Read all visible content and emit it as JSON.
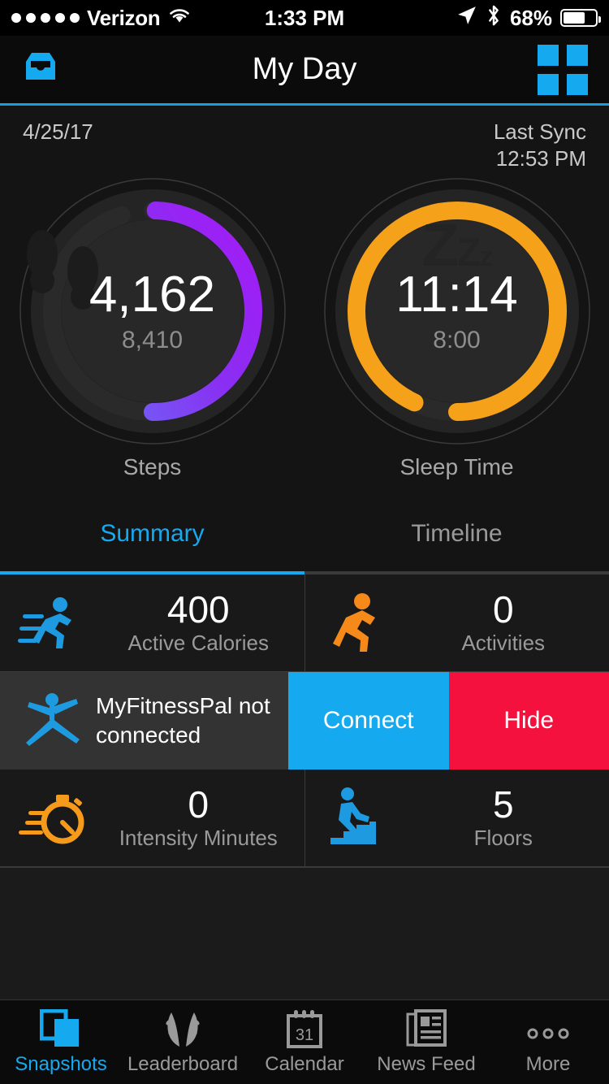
{
  "status_bar": {
    "carrier": "Verizon",
    "signal_dots": 5,
    "wifi_icon": "wifi-icon",
    "time": "1:33 PM",
    "location_icon": "location-arrow-icon",
    "bluetooth_icon": "bluetooth-icon",
    "battery_percent": "68%",
    "battery_level": 68
  },
  "navbar": {
    "inbox_icon": "inbox-tray-icon",
    "title": "My Day",
    "grid_icon": "grid-squares-icon"
  },
  "sync": {
    "date": "4/25/17",
    "last_sync_label": "Last Sync",
    "last_sync_time": "12:53 PM"
  },
  "rings": [
    {
      "name": "steps",
      "value": "4,162",
      "goal": "8,410",
      "label": "Steps",
      "icon": "footprints-icon",
      "progress": 0.495,
      "color_start": "#6a6cf5",
      "color_end": "#a21cf5",
      "track_color": "#2a2a2a"
    },
    {
      "name": "sleep",
      "value": "11:14",
      "goal": "8:00",
      "label": "Sleep Time",
      "icon": "zzz-sleep-icon",
      "progress": 0.93,
      "color_start": "#F5A21A",
      "color_end": "#F5A21A",
      "track_color": "#2a2a2a"
    }
  ],
  "tabs": {
    "items": [
      {
        "label": "Summary",
        "active": true
      },
      {
        "label": "Timeline",
        "active": false
      }
    ],
    "active_color": "#15A9EF"
  },
  "stats": {
    "row1": [
      {
        "value": "400",
        "label": "Active Calories",
        "icon": "running-person-icon",
        "color": "#1E9BE0"
      },
      {
        "value": "0",
        "label": "Activities",
        "icon": "running-person-icon",
        "color": "#F58A1A"
      }
    ],
    "row3": [
      {
        "value": "0",
        "label": "Intensity Minutes",
        "icon": "stopwatch-icon",
        "color": "#F59A1A"
      },
      {
        "value": "5",
        "label": "Floors",
        "icon": "stairs-climber-icon",
        "color": "#1E9BE0"
      }
    ]
  },
  "mfp": {
    "icon": "jumping-person-icon",
    "message": "MyFitnessPal not connected",
    "connect_label": "Connect",
    "hide_label": "Hide",
    "connect_color": "#15A9EF",
    "hide_color": "#F4113D"
  },
  "page_dots": {
    "count": 6,
    "active_index": 0
  },
  "tabbar": {
    "items": [
      {
        "label": "Snapshots",
        "icon": "snapshots-cards-icon",
        "active": true
      },
      {
        "label": "Leaderboard",
        "icon": "laurel-wreath-icon",
        "active": false
      },
      {
        "label": "Calendar",
        "icon": "calendar-31-icon",
        "active": false
      },
      {
        "label": "News Feed",
        "icon": "newspaper-icon",
        "active": false
      },
      {
        "label": "More",
        "icon": "ellipsis-icon",
        "active": false
      }
    ]
  }
}
